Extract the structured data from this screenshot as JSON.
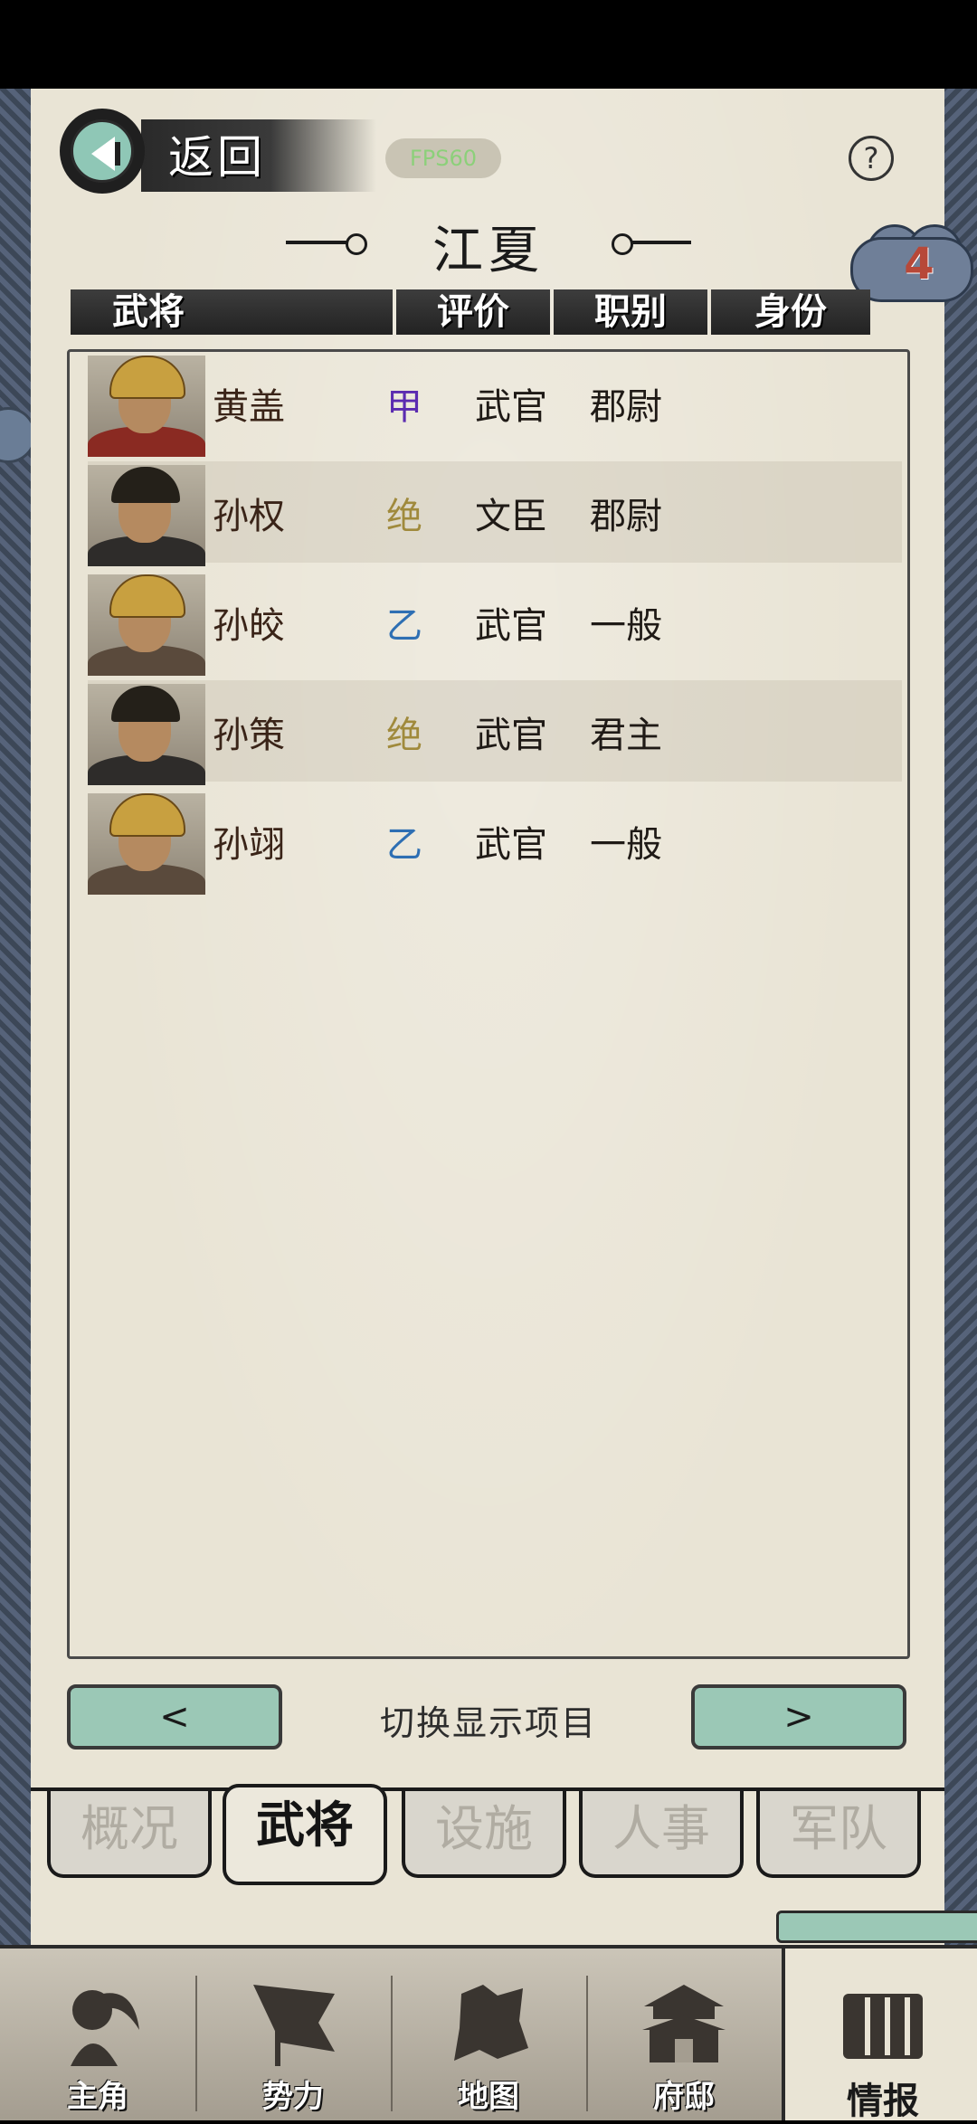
{
  "top": {
    "back_label": "返回",
    "fps": "FPS60",
    "help": "?",
    "title": "江夏",
    "badge_count": "4"
  },
  "header": [
    "武将",
    "评价",
    "职别",
    "身份"
  ],
  "officers": [
    {
      "name": "黄盖",
      "grade": "甲",
      "grade_color": "#5b2bb0",
      "role": "武官",
      "rank": "郡尉",
      "portrait": "helmet-red"
    },
    {
      "name": "孙权",
      "grade": "绝",
      "grade_color": "#a08a3c",
      "role": "文臣",
      "rank": "郡尉",
      "portrait": "hair-dark"
    },
    {
      "name": "孙皎",
      "grade": "乙",
      "grade_color": "#2e6fb3",
      "role": "武官",
      "rank": "一般",
      "portrait": "helmet"
    },
    {
      "name": "孙策",
      "grade": "绝",
      "grade_color": "#a08a3c",
      "role": "武官",
      "rank": "君主",
      "portrait": "hair-dark"
    },
    {
      "name": "孙翊",
      "grade": "乙",
      "grade_color": "#2e6fb3",
      "role": "武官",
      "rank": "一般",
      "portrait": "helmet"
    }
  ],
  "switcher": {
    "prev": "<",
    "label": "切换显示项目",
    "next": ">"
  },
  "tabs": [
    {
      "label": "概况",
      "active": false
    },
    {
      "label": "武将",
      "active": true
    },
    {
      "label": "设施",
      "active": false
    },
    {
      "label": "人事",
      "active": false
    },
    {
      "label": "军队",
      "active": false
    }
  ],
  "nav": [
    {
      "label": "主角",
      "icon": "hero-icon"
    },
    {
      "label": "势力",
      "icon": "flag-icon"
    },
    {
      "label": "地图",
      "icon": "map-icon"
    },
    {
      "label": "府邸",
      "icon": "mansion-icon"
    },
    {
      "label": "情报",
      "icon": "scroll-icon",
      "active": true
    }
  ]
}
